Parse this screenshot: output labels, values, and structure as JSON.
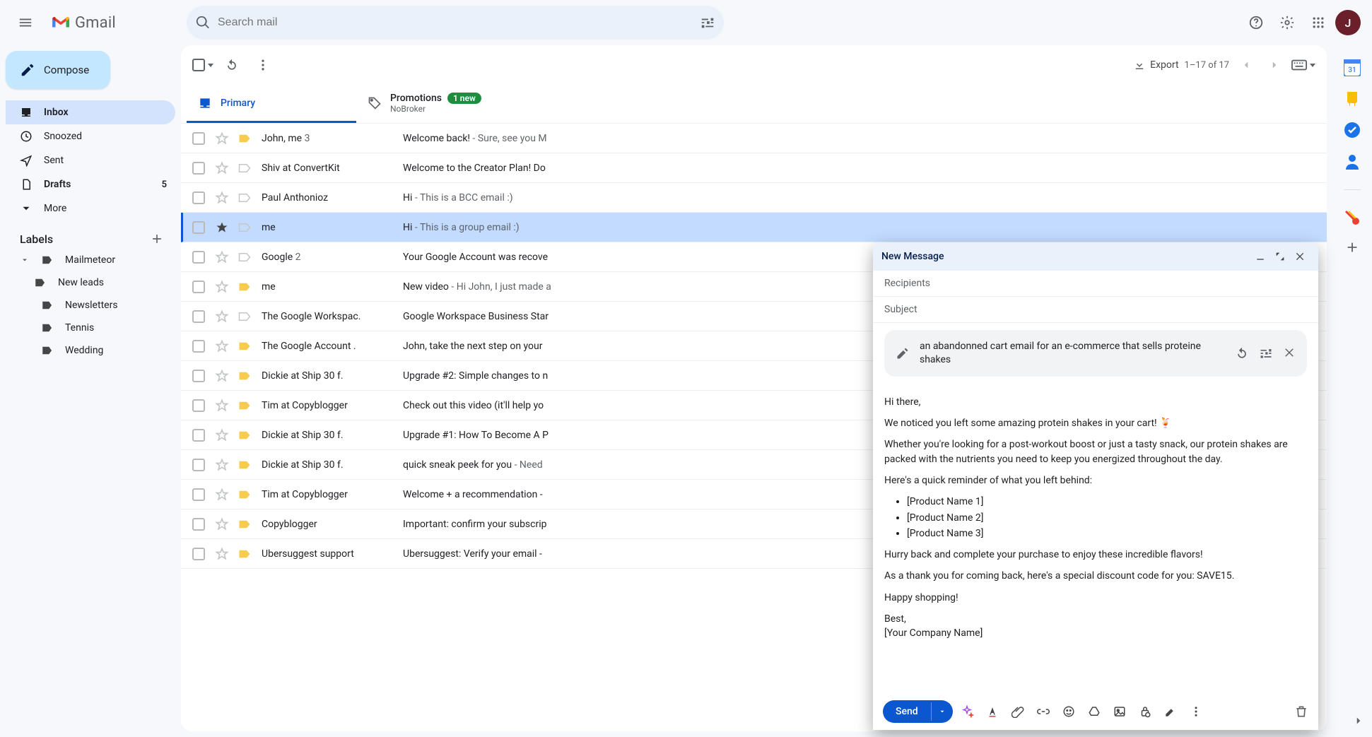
{
  "header": {
    "logo_text": "Gmail",
    "search_placeholder": "Search mail",
    "avatar_letter": "J"
  },
  "sidebar": {
    "compose_label": "Compose",
    "items": [
      {
        "icon": "inbox",
        "label": "Inbox",
        "active": true,
        "bold": true,
        "count": ""
      },
      {
        "icon": "clock",
        "label": "Snoozed"
      },
      {
        "icon": "send",
        "label": "Sent"
      },
      {
        "icon": "file",
        "label": "Drafts",
        "bold": true,
        "count": "5"
      },
      {
        "icon": "chev",
        "label": "More"
      }
    ],
    "labels_heading": "Labels",
    "labels": [
      {
        "label": "Mailmeteor",
        "hasChildren": true
      },
      {
        "label": "New leads",
        "child": true
      },
      {
        "label": "Newsletters"
      },
      {
        "label": "Tennis"
      },
      {
        "label": "Wedding"
      }
    ]
  },
  "toolbar": {
    "export_label": "Export",
    "pager_text": "1–17 of 17"
  },
  "tabs": {
    "primary": {
      "label": "Primary"
    },
    "promotions": {
      "label": "Promotions",
      "badge": "1 new",
      "sub": "NoBroker"
    }
  },
  "rows": [
    {
      "sender": "John, me",
      "extra": " 3",
      "marker": "important-yellow",
      "subj": "Welcome back!",
      "snippet": " - Sure, see you M"
    },
    {
      "sender": "Shiv at ConvertKit",
      "marker": "important-gray",
      "subj": "Welcome to the Creator Plan! Do",
      "snippet": ""
    },
    {
      "sender": "Paul Anthonioz",
      "marker": "important-gray",
      "subj": "Hi",
      "snippet": " - This is a BCC email :)"
    },
    {
      "sender": "me",
      "marker": "important-gray",
      "subj": "Hi",
      "snippet": " - This is a group email :)",
      "selected": true,
      "starred": true
    },
    {
      "sender": "Google",
      "extra": " 2",
      "marker": "important-gray",
      "subj": "Your Google Account was recove",
      "snippet": ""
    },
    {
      "sender": "me",
      "marker": "important-yellow",
      "subj": "New video",
      "snippet": " - Hi John, I just made a"
    },
    {
      "sender": "The Google Workspac.",
      "marker": "important-gray",
      "subj": "Google Workspace Business Star",
      "snippet": ""
    },
    {
      "sender": "The Google Account .",
      "marker": "important-yellow",
      "subj": "John, take the next step on your",
      "snippet": ""
    },
    {
      "sender": "Dickie at Ship 30 f.",
      "marker": "important-yellow",
      "subj": "Upgrade #2: Simple changes to n",
      "snippet": ""
    },
    {
      "sender": "Tim at Copyblogger",
      "marker": "important-yellow",
      "subj": "Check out this video (it'll help yo",
      "snippet": ""
    },
    {
      "sender": "Dickie at Ship 30 f.",
      "marker": "important-yellow",
      "subj": "Upgrade #1: How To Become A P",
      "snippet": ""
    },
    {
      "sender": "Dickie at Ship 30 f.",
      "marker": "important-yellow",
      "subj": "quick sneak peek for you",
      "snippet": " - Need"
    },
    {
      "sender": "Tim at Copyblogger",
      "marker": "important-yellow",
      "subj": "Welcome + a recommendation -",
      "snippet": ""
    },
    {
      "sender": "Copyblogger",
      "marker": "important-yellow",
      "subj": "Important: confirm your subscrip",
      "snippet": ""
    },
    {
      "sender": "Ubersuggest support",
      "marker": "important-yellow",
      "subj": "Ubersuggest: Verify your email -",
      "snippet": ""
    }
  ],
  "compose": {
    "title": "New Message",
    "recipients_ph": "Recipients",
    "subject_ph": "Subject",
    "ai_prompt": "an abandonned cart email for an e-commerce that sells proteine shakes",
    "body": {
      "greeting": "Hi there,",
      "p1": "We noticed you left some amazing protein shakes in your cart! 🍹",
      "p2": "Whether you're looking for a post-workout boost or just a tasty snack, our protein shakes are packed with the nutrients you need to keep you energized throughout the day.",
      "p3": "Here's a quick reminder of what you left behind:",
      "items": [
        "[Product Name 1]",
        "[Product Name 2]",
        "[Product Name 3]"
      ],
      "p4": "Hurry back and complete your purchase to enjoy these incredible flavors!",
      "p5": "As a thank you for coming back, here's a special discount code for you: SAVE15.",
      "p6": "Happy shopping!",
      "sign1": "Best,",
      "sign2": "[Your Company Name]"
    },
    "send_label": "Send"
  },
  "sidepanel": {
    "apps": [
      {
        "name": "calendar-icon",
        "color": "#4285f4",
        "letter": "31"
      },
      {
        "name": "keep-icon",
        "color": "#fbbc04"
      },
      {
        "name": "tasks-icon",
        "color": "#1a73e8"
      },
      {
        "name": "contacts-icon",
        "color": "#1a73e8"
      }
    ]
  }
}
